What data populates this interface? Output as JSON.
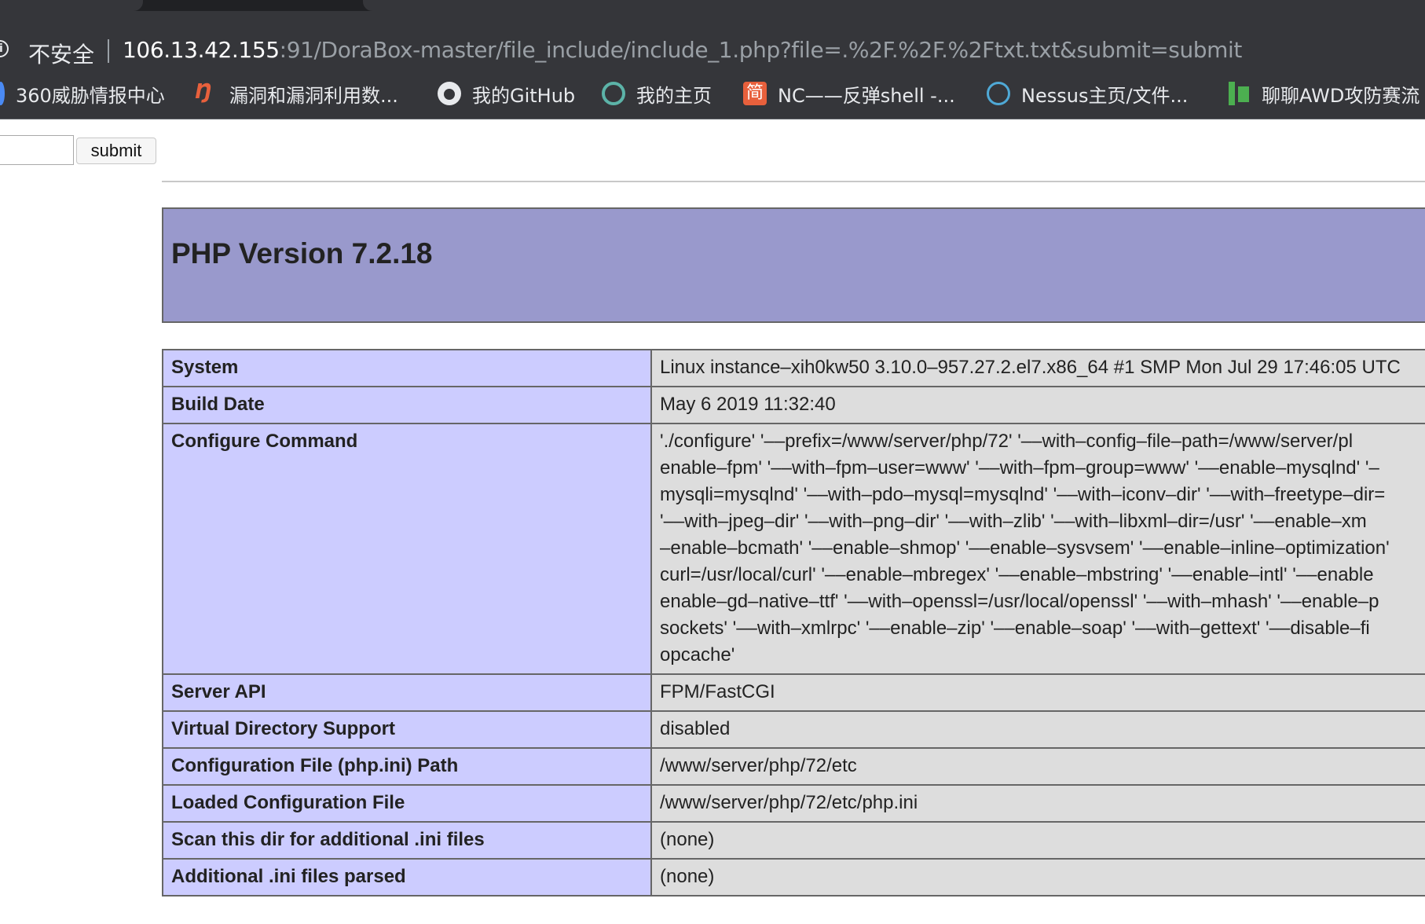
{
  "browser": {
    "security_label": "不安全",
    "url_host": "106.13.42.155",
    "url_rest": ":91/DoraBox-master/file_include/include_1.php?file=.%2F.%2F.%2Ftxt.txt&submit=submit"
  },
  "bookmarks": [
    {
      "label": "360威胁情报中心",
      "icon": "360-icon"
    },
    {
      "label": "漏洞和漏洞利用数...",
      "icon": "vuln-db-icon"
    },
    {
      "label": "我的GitHub",
      "icon": "github-icon"
    },
    {
      "label": "我的主页",
      "icon": "homepage-icon"
    },
    {
      "label": "NC——反弹shell -...",
      "icon": "jianshu-icon",
      "icon_glyph": "简"
    },
    {
      "label": "Nessus主页/文件...",
      "icon": "nessus-icon"
    },
    {
      "label": "聊聊AWD攻防赛流",
      "icon": "awd-icon"
    }
  ],
  "form": {
    "file_value": "",
    "submit_label": "submit"
  },
  "phpinfo": {
    "title": "PHP Version 7.2.18",
    "rows": [
      {
        "key": "System",
        "value": [
          "Linux instance–xih0kw50 3.10.0–957.27.2.el7.x86_64 #1 SMP Mon Jul 29 17:46:05 UTC"
        ]
      },
      {
        "key": "Build Date",
        "value": [
          "May 6 2019 11:32:40"
        ]
      },
      {
        "key": "Configure Command",
        "value": [
          "'./configure' '––prefix=/www/server/php/72' '––with–config–file–path=/www/server/pl",
          "enable–fpm' '––with–fpm–user=www' '––with–fpm–group=www' '––enable–mysqlnd' '–",
          "mysqli=mysqlnd' '––with–pdo–mysql=mysqlnd' '––with–iconv–dir' '––with–freetype–dir=",
          "'––with–jpeg–dir' '––with–png–dir' '––with–zlib' '––with–libxml–dir=/usr' '––enable–xm",
          "–enable–bcmath' '––enable–shmop' '––enable–sysvsem' '––enable–inline–optimization'",
          "curl=/usr/local/curl' '––enable–mbregex' '––enable–mbstring' '––enable–intl' '––enable",
          "enable–gd–native–ttf' '––with–openssl=/usr/local/openssl' '––with–mhash' '––enable–p",
          "sockets' '––with–xmlrpc' '––enable–zip' '––enable–soap' '––with–gettext' '––disable–fi",
          "opcache'"
        ]
      },
      {
        "key": "Server API",
        "value": [
          "FPM/FastCGI"
        ]
      },
      {
        "key": "Virtual Directory Support",
        "value": [
          "disabled"
        ]
      },
      {
        "key": "Configuration File (php.ini) Path",
        "value": [
          "/www/server/php/72/etc"
        ]
      },
      {
        "key": "Loaded Configuration File",
        "value": [
          "/www/server/php/72/etc/php.ini"
        ]
      },
      {
        "key": "Scan this dir for additional .ini files",
        "value": [
          "(none)"
        ]
      },
      {
        "key": "Additional .ini files parsed",
        "value": [
          "(none)"
        ]
      }
    ]
  }
}
